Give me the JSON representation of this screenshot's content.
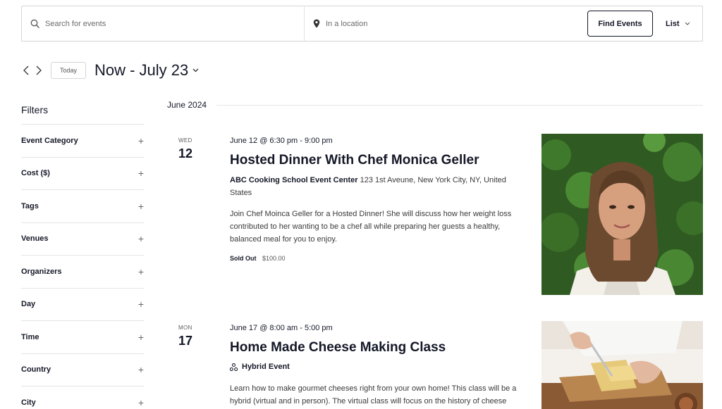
{
  "search": {
    "keyword_placeholder": "Search for events",
    "location_placeholder": "In a location",
    "find_button": "Find Events",
    "view_label": "List"
  },
  "datenav": {
    "today_label": "Today",
    "range_label": "Now - July 23"
  },
  "filters": {
    "title": "Filters",
    "items": [
      {
        "label": "Event Category"
      },
      {
        "label": "Cost ($)"
      },
      {
        "label": "Tags"
      },
      {
        "label": "Venues"
      },
      {
        "label": "Organizers"
      },
      {
        "label": "Day"
      },
      {
        "label": "Time"
      },
      {
        "label": "Country"
      },
      {
        "label": "City"
      }
    ]
  },
  "month_label": "June 2024",
  "events": [
    {
      "dow": "WED",
      "day": "12",
      "time": "June 12 @ 6:30 pm - 9:00 pm",
      "title": "Hosted Dinner With Chef Monica Geller",
      "venue_name": "ABC Cooking School Event Center",
      "venue_address": "123 1st Aveune, New York City, NY, United States",
      "description": "Join Chef Moinca Geller for a Hosted Dinner! She will discuss how her weight loss contributed to her wanting to be a chef all while preparing her guests a healthy, balanced meal for you to enjoy.",
      "sold_out": "Sold Out",
      "price": "$100.00"
    },
    {
      "dow": "MON",
      "day": "17",
      "time": "June 17 @ 8:00 am - 5:00 pm",
      "title": "Home Made Cheese Making Class",
      "hybrid_label": "Hybrid Event",
      "description": "Learn how to make gourmet cheeses right from your own home! This class will be a hybrid (virtual and in person). The virtual class will focus on the history of cheese"
    }
  ],
  "colors": {
    "text": "#141827",
    "border": "#d5d5d5",
    "divider": "#e4e4e4"
  }
}
